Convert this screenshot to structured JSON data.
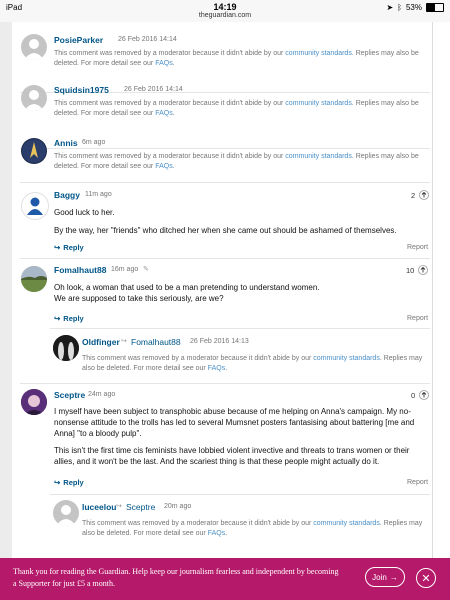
{
  "status_bar": {
    "device": "iPad",
    "time": "14:19",
    "url": "theguardian.com",
    "battery": "53%"
  },
  "removed_text": "This comment was removed by a moderator because it didn't abide by our",
  "removed_link": "community standards",
  "removed_tail": ". Replies may also be deleted. For more detail see our",
  "faq_link": "FAQs",
  "reply_label": "Reply",
  "report_label": "Report",
  "comments": [
    {
      "user": "PosieParker",
      "time": "26 Feb 2016 14:14"
    },
    {
      "user": "Squidsin1975",
      "time": "26 Feb 2016 14:14"
    },
    {
      "user": "Annis",
      "time": "6m ago"
    },
    {
      "user": "Baggy",
      "time": "11m ago",
      "votes": "2",
      "lines": [
        "Good luck to her.",
        "By the way, her \"friends\" who ditched her when she came out should be ashamed of themselves."
      ]
    },
    {
      "user": "Fomalhaut88",
      "time": "16m ago",
      "votes": "10",
      "lines": [
        "Oh look, a woman that used to be a man pretending to understand women.",
        "We are supposed to take this seriously, are we?"
      ]
    },
    {
      "user": "Oldfinger",
      "reply_to": "Fomalhaut88",
      "time": "26 Feb 2016 14:13"
    },
    {
      "user": "Sceptre",
      "time": "24m ago",
      "votes": "0",
      "lines": [
        "I myself have been subject to transphobic abuse because of me helping on Anna's campaign. My no-nonsense attitude to the trolls has led to several Mumsnet posters fantasising about battering [me and Anna] \"to a bloody pulp\".",
        "This isn't the first time cis feminists have lobbied violent invective and threats to trans women or their allies, and it won't be the last. And the scariest thing is that these people might actually do it."
      ]
    },
    {
      "user": "luceelou",
      "reply_to": "Sceptre",
      "time": "20m ago"
    }
  ],
  "banner": {
    "text": "Thank you for reading the Guardian. Help keep our journalism fearless and independent by becoming a Supporter for just £5 a month.",
    "join": "Join"
  },
  "colors": {
    "link": "#005689",
    "banner": "#b51a6a",
    "muted": "#767676"
  }
}
